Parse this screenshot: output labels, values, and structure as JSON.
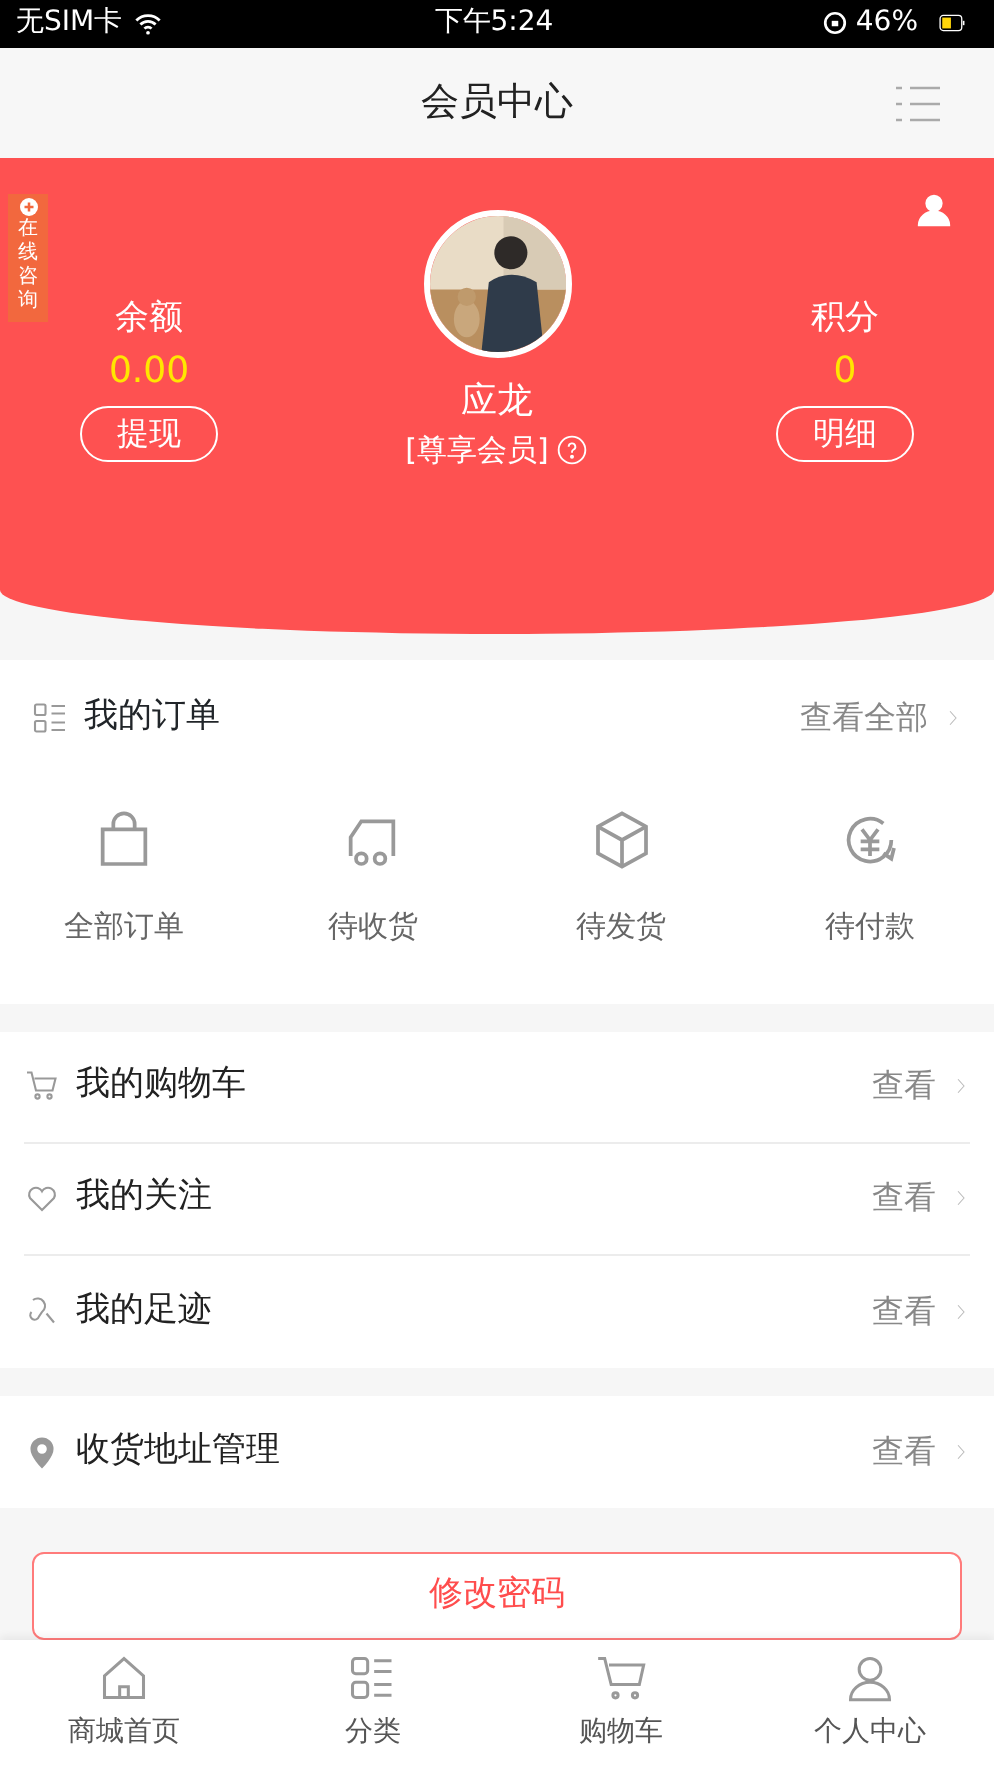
{
  "status_bar": {
    "carrier": "无SIM卡",
    "time": "下午5:24",
    "battery": "46%"
  },
  "navbar": {
    "title": "会员中心"
  },
  "profile": {
    "consult_tab": "在线咨询",
    "balance": {
      "label": "余额",
      "value": "0.00",
      "button": "提现"
    },
    "name": "应龙",
    "member_level": "[尊享会员]",
    "points": {
      "label": "积分",
      "value": "0",
      "button": "明细"
    }
  },
  "orders": {
    "title": "我的订单",
    "link": "查看全部",
    "statuses": [
      {
        "label": "全部订单"
      },
      {
        "label": "待收货"
      },
      {
        "label": "待发货"
      },
      {
        "label": "待付款"
      }
    ]
  },
  "menu_groups": [
    [
      {
        "label": "我的购物车",
        "action": "查看"
      },
      {
        "label": "我的关注",
        "action": "查看"
      },
      {
        "label": "我的足迹",
        "action": "查看"
      }
    ],
    [
      {
        "label": "收货地址管理",
        "action": "查看"
      }
    ]
  ],
  "change_password_button": "修改密码",
  "tab_bar": [
    {
      "label": "商城首页"
    },
    {
      "label": "分类"
    },
    {
      "label": "购物车"
    },
    {
      "label": "个人中心"
    }
  ]
}
